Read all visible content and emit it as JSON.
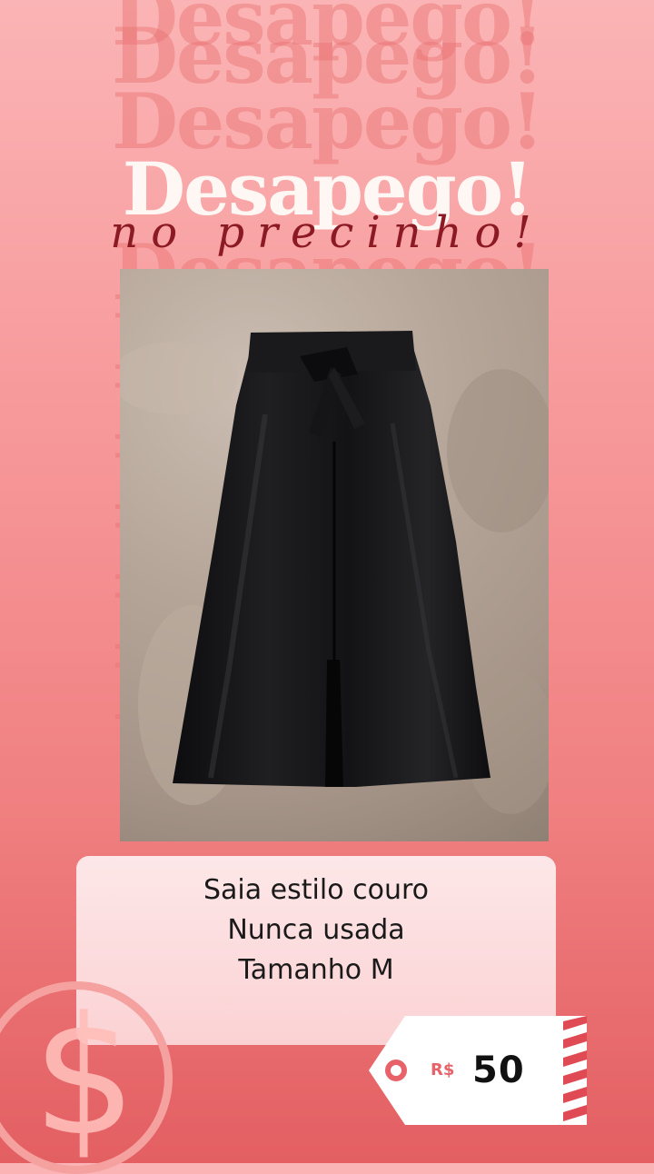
{
  "background": {
    "repeated_word": "Desapego!",
    "colors": {
      "top": "#fbb4b5",
      "bottom": "#e35f62",
      "word": "#e87070"
    }
  },
  "header": {
    "title": "Desapego!",
    "subtitle": "no precinho!",
    "title_color": "#fff7f3",
    "subtitle_color": "#8c1a24"
  },
  "product": {
    "photo_subject": "black leather-style skirt on rug",
    "description_lines": [
      "Saia estilo couro",
      "Nunca usada",
      "Tamanho M"
    ]
  },
  "price_tag": {
    "currency": "R$",
    "amount": "50",
    "accent_color": "#e8626a"
  },
  "icons": {
    "decor": "dollar-sign-icon",
    "tag": "price-tag-icon"
  }
}
